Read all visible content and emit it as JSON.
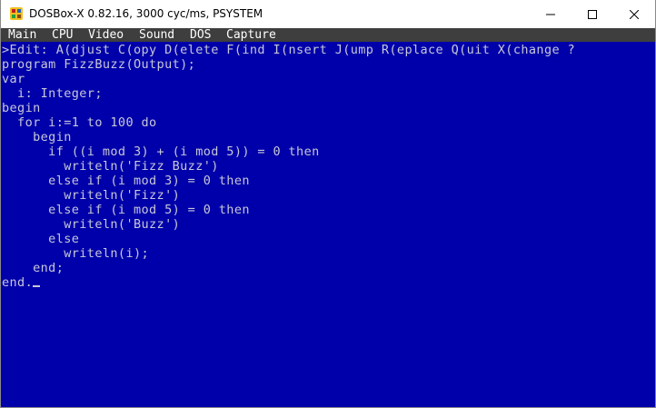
{
  "window": {
    "title": "DOSBox-X 0.82.16, 3000 cyc/ms, PSYSTEM"
  },
  "menubar": {
    "items": [
      "Main",
      "CPU",
      "Video",
      "Sound",
      "DOS",
      "Capture"
    ]
  },
  "editor": {
    "prompt": ">Edit: A(djust C(opy D(elete F(ind I(nsert J(ump R(eplace Q(uit X(change ?",
    "lines": [
      "program FizzBuzz(Output);",
      "var",
      "  i: Integer;",
      "begin",
      "  for i:=1 to 100 do",
      "    begin",
      "      if ((i mod 3) + (i mod 5)) = 0 then",
      "        writeln('Fizz Buzz')",
      "      else if (i mod 3) = 0 then",
      "        writeln('Fizz')",
      "      else if (i mod 5) = 0 then",
      "        writeln('Buzz')",
      "      else",
      "        writeln(i);",
      "    end;",
      "end."
    ]
  },
  "colors": {
    "screen_bg": "#0000aa",
    "text": "#c8c8d8",
    "menubar_bg": "#3e3e3e"
  }
}
